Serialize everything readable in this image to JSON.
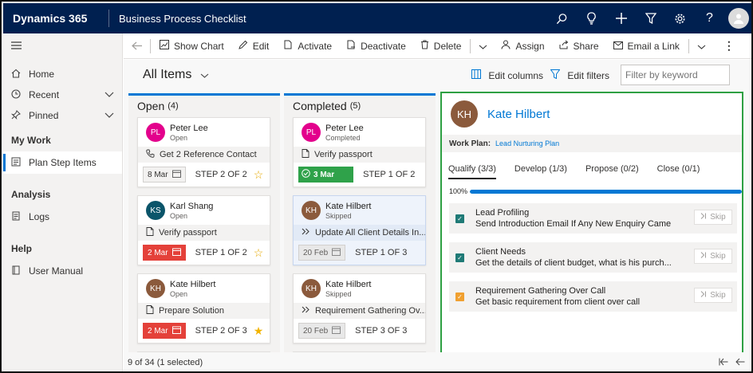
{
  "topbar": {
    "brand": "Dynamics 365",
    "app_name": "Business Process Checklist",
    "icons": [
      "search-icon",
      "lightbulb-icon",
      "plus-icon",
      "filter-icon",
      "gear-icon",
      "help-icon",
      "avatar"
    ]
  },
  "leftnav": {
    "items": [
      {
        "label": "Home",
        "icon": "home-icon"
      },
      {
        "label": "Recent",
        "icon": "clock-icon",
        "chevron": true
      },
      {
        "label": "Pinned",
        "icon": "pin-icon",
        "chevron": true
      }
    ],
    "sections": [
      {
        "title": "My Work",
        "items": [
          {
            "label": "Plan Step Items",
            "icon": "list-icon",
            "selected": true
          }
        ]
      },
      {
        "title": "Analysis",
        "items": [
          {
            "label": "Logs",
            "icon": "logs-icon"
          }
        ]
      },
      {
        "title": "Help",
        "items": [
          {
            "label": "User Manual",
            "icon": "book-icon"
          }
        ]
      }
    ]
  },
  "commandbar": {
    "show_chart": "Show Chart",
    "edit": "Edit",
    "activate": "Activate",
    "deactivate": "Deactivate",
    "delete": "Delete",
    "assign": "Assign",
    "share": "Share",
    "email_link": "Email a Link"
  },
  "view": {
    "title": "All Items",
    "edit_columns": "Edit columns",
    "edit_filters": "Edit filters",
    "keyword_placeholder": "Filter by keyword"
  },
  "columns": {
    "open": {
      "title": "Open",
      "count": "(4)",
      "cards": [
        {
          "initials": "PL",
          "color": "#e3008c",
          "name": "Peter Lee",
          "status": "Open",
          "task_icon": "phone-icon",
          "task": "Get 2 Reference Contact",
          "date": "8 Mar",
          "date_style": "plain",
          "step": "STEP 2 OF 2",
          "star": "outline"
        },
        {
          "initials": "KS",
          "color": "#0b556a",
          "name": "Karl Shang",
          "status": "Open",
          "task_icon": "document-icon",
          "task": "Verify passport",
          "date": "2 Mar",
          "date_style": "red",
          "step": "STEP 1 OF 2",
          "star": "outline"
        },
        {
          "initials": "KH",
          "color": "#8b5a3c",
          "name": "Kate Hilbert",
          "status": "Open",
          "task_icon": "document-icon",
          "task": "Prepare Solution",
          "date": "2 Mar",
          "date_style": "red",
          "step": "STEP 2 OF 3",
          "star": "filled"
        }
      ]
    },
    "completed": {
      "title": "Completed",
      "count": "(5)",
      "cards": [
        {
          "initials": "PL",
          "color": "#e3008c",
          "name": "Peter Lee",
          "status": "Completed",
          "task_icon": "document-icon",
          "task": "Verify passport",
          "date": "3 Mar",
          "date_style": "green",
          "step": "STEP 1 OF 2"
        },
        {
          "initials": "KH",
          "color": "#8b5a3c",
          "name": "Kate Hilbert",
          "status": "Skipped",
          "task_icon": "skip-forward-icon",
          "task": "Update All Client Details In...",
          "date": "20 Feb",
          "date_style": "grey",
          "step": "STEP 1 OF 3",
          "selected": true
        },
        {
          "initials": "KH",
          "color": "#8b5a3c",
          "name": "Kate Hilbert",
          "status": "Skipped",
          "task_icon": "skip-forward-icon",
          "task": "Requirement Gathering Ov...",
          "date": "20 Feb",
          "date_style": "grey",
          "step": "STEP 3 OF 3"
        }
      ]
    }
  },
  "detail": {
    "initials": "KH",
    "name": "Kate Hilbert",
    "work_plan_label": "Work Plan:",
    "work_plan_value": "Lead Nurturing Plan",
    "tabs": [
      "Qualify (3/3)",
      "Develop (1/3)",
      "Propose (0/2)",
      "Close (0/1)"
    ],
    "progress_label": "100%",
    "progress": 1.0,
    "skip_label": "Skip",
    "items": [
      {
        "title": "Lead Profiling",
        "desc": "Send Introduction Email If Any New Enquiry Came",
        "check": "teal"
      },
      {
        "title": "Client Needs",
        "desc": "Get the details of client budget, what is his purch...",
        "check": "teal"
      },
      {
        "title": "Requirement Gathering Over Call",
        "desc": "Get basic requirement from client over call",
        "check": "orange"
      }
    ]
  },
  "footer": {
    "count_text": "9 of 34 (1 selected)"
  }
}
